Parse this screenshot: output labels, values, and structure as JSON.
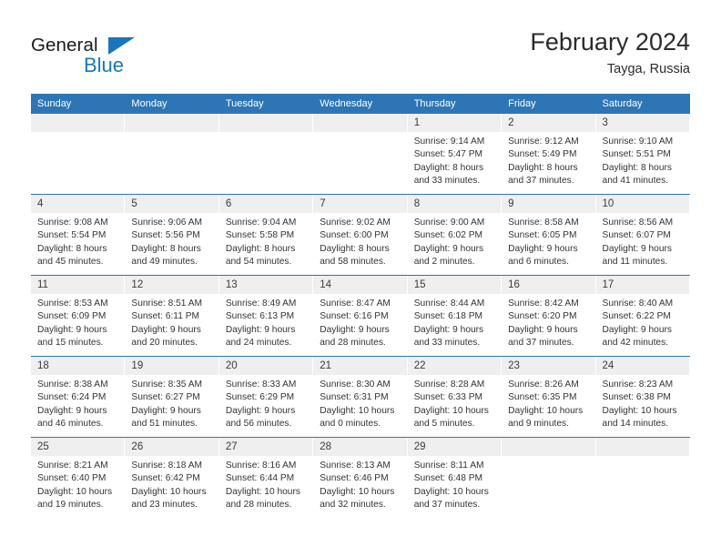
{
  "brand": {
    "name_top": "General",
    "name_bottom": "Blue",
    "accent_color": "#1b75bb"
  },
  "header": {
    "title": "February 2024",
    "subtitle": "Tayga, Russia"
  },
  "theme": {
    "header_blue": "#2e75b6",
    "day_band_gray": "#efefef",
    "text_color": "#333333"
  },
  "weekdays": [
    "Sunday",
    "Monday",
    "Tuesday",
    "Wednesday",
    "Thursday",
    "Friday",
    "Saturday"
  ],
  "weeks": [
    [
      {
        "day": "",
        "lines": []
      },
      {
        "day": "",
        "lines": []
      },
      {
        "day": "",
        "lines": []
      },
      {
        "day": "",
        "lines": []
      },
      {
        "day": "1",
        "lines": [
          "Sunrise: 9:14 AM",
          "Sunset: 5:47 PM",
          "Daylight: 8 hours",
          "and 33 minutes."
        ]
      },
      {
        "day": "2",
        "lines": [
          "Sunrise: 9:12 AM",
          "Sunset: 5:49 PM",
          "Daylight: 8 hours",
          "and 37 minutes."
        ]
      },
      {
        "day": "3",
        "lines": [
          "Sunrise: 9:10 AM",
          "Sunset: 5:51 PM",
          "Daylight: 8 hours",
          "and 41 minutes."
        ]
      }
    ],
    [
      {
        "day": "4",
        "lines": [
          "Sunrise: 9:08 AM",
          "Sunset: 5:54 PM",
          "Daylight: 8 hours",
          "and 45 minutes."
        ]
      },
      {
        "day": "5",
        "lines": [
          "Sunrise: 9:06 AM",
          "Sunset: 5:56 PM",
          "Daylight: 8 hours",
          "and 49 minutes."
        ]
      },
      {
        "day": "6",
        "lines": [
          "Sunrise: 9:04 AM",
          "Sunset: 5:58 PM",
          "Daylight: 8 hours",
          "and 54 minutes."
        ]
      },
      {
        "day": "7",
        "lines": [
          "Sunrise: 9:02 AM",
          "Sunset: 6:00 PM",
          "Daylight: 8 hours",
          "and 58 minutes."
        ]
      },
      {
        "day": "8",
        "lines": [
          "Sunrise: 9:00 AM",
          "Sunset: 6:02 PM",
          "Daylight: 9 hours",
          "and 2 minutes."
        ]
      },
      {
        "day": "9",
        "lines": [
          "Sunrise: 8:58 AM",
          "Sunset: 6:05 PM",
          "Daylight: 9 hours",
          "and 6 minutes."
        ]
      },
      {
        "day": "10",
        "lines": [
          "Sunrise: 8:56 AM",
          "Sunset: 6:07 PM",
          "Daylight: 9 hours",
          "and 11 minutes."
        ]
      }
    ],
    [
      {
        "day": "11",
        "lines": [
          "Sunrise: 8:53 AM",
          "Sunset: 6:09 PM",
          "Daylight: 9 hours",
          "and 15 minutes."
        ]
      },
      {
        "day": "12",
        "lines": [
          "Sunrise: 8:51 AM",
          "Sunset: 6:11 PM",
          "Daylight: 9 hours",
          "and 20 minutes."
        ]
      },
      {
        "day": "13",
        "lines": [
          "Sunrise: 8:49 AM",
          "Sunset: 6:13 PM",
          "Daylight: 9 hours",
          "and 24 minutes."
        ]
      },
      {
        "day": "14",
        "lines": [
          "Sunrise: 8:47 AM",
          "Sunset: 6:16 PM",
          "Daylight: 9 hours",
          "and 28 minutes."
        ]
      },
      {
        "day": "15",
        "lines": [
          "Sunrise: 8:44 AM",
          "Sunset: 6:18 PM",
          "Daylight: 9 hours",
          "and 33 minutes."
        ]
      },
      {
        "day": "16",
        "lines": [
          "Sunrise: 8:42 AM",
          "Sunset: 6:20 PM",
          "Daylight: 9 hours",
          "and 37 minutes."
        ]
      },
      {
        "day": "17",
        "lines": [
          "Sunrise: 8:40 AM",
          "Sunset: 6:22 PM",
          "Daylight: 9 hours",
          "and 42 minutes."
        ]
      }
    ],
    [
      {
        "day": "18",
        "lines": [
          "Sunrise: 8:38 AM",
          "Sunset: 6:24 PM",
          "Daylight: 9 hours",
          "and 46 minutes."
        ]
      },
      {
        "day": "19",
        "lines": [
          "Sunrise: 8:35 AM",
          "Sunset: 6:27 PM",
          "Daylight: 9 hours",
          "and 51 minutes."
        ]
      },
      {
        "day": "20",
        "lines": [
          "Sunrise: 8:33 AM",
          "Sunset: 6:29 PM",
          "Daylight: 9 hours",
          "and 56 minutes."
        ]
      },
      {
        "day": "21",
        "lines": [
          "Sunrise: 8:30 AM",
          "Sunset: 6:31 PM",
          "Daylight: 10 hours",
          "and 0 minutes."
        ]
      },
      {
        "day": "22",
        "lines": [
          "Sunrise: 8:28 AM",
          "Sunset: 6:33 PM",
          "Daylight: 10 hours",
          "and 5 minutes."
        ]
      },
      {
        "day": "23",
        "lines": [
          "Sunrise: 8:26 AM",
          "Sunset: 6:35 PM",
          "Daylight: 10 hours",
          "and 9 minutes."
        ]
      },
      {
        "day": "24",
        "lines": [
          "Sunrise: 8:23 AM",
          "Sunset: 6:38 PM",
          "Daylight: 10 hours",
          "and 14 minutes."
        ]
      }
    ],
    [
      {
        "day": "25",
        "lines": [
          "Sunrise: 8:21 AM",
          "Sunset: 6:40 PM",
          "Daylight: 10 hours",
          "and 19 minutes."
        ]
      },
      {
        "day": "26",
        "lines": [
          "Sunrise: 8:18 AM",
          "Sunset: 6:42 PM",
          "Daylight: 10 hours",
          "and 23 minutes."
        ]
      },
      {
        "day": "27",
        "lines": [
          "Sunrise: 8:16 AM",
          "Sunset: 6:44 PM",
          "Daylight: 10 hours",
          "and 28 minutes."
        ]
      },
      {
        "day": "28",
        "lines": [
          "Sunrise: 8:13 AM",
          "Sunset: 6:46 PM",
          "Daylight: 10 hours",
          "and 32 minutes."
        ]
      },
      {
        "day": "29",
        "lines": [
          "Sunrise: 8:11 AM",
          "Sunset: 6:48 PM",
          "Daylight: 10 hours",
          "and 37 minutes."
        ]
      },
      {
        "day": "",
        "lines": []
      },
      {
        "day": "",
        "lines": []
      }
    ]
  ]
}
